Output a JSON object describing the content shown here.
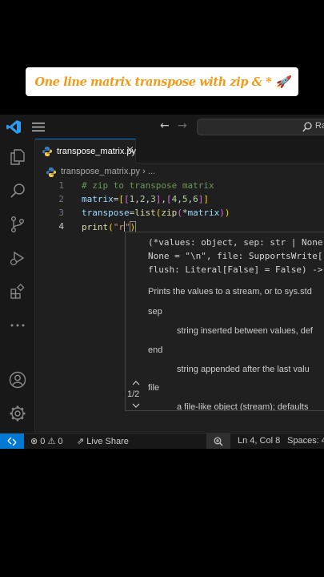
{
  "banner": {
    "text": "One line matrix transpose with zip & * 🚀"
  },
  "titlebar": {
    "search_text": "Ra"
  },
  "tab": {
    "label": "transpose_matrix.py",
    "close": "×"
  },
  "breadcrumb": {
    "text": "transpose_matrix.py › ..."
  },
  "editor": {
    "line_numbers": [
      "1",
      "2",
      "3",
      "4"
    ],
    "lines": [
      "# zip to transpose matrix",
      "matrix=[[1,2,3],[4,5,6]]",
      "transpose=list(zip(*matrix))",
      "print(\"r\")"
    ]
  },
  "hover": {
    "signature_lines": [
      "(*values: object, sep: str | None",
      "None = \"\\n\", file: SupportsWrite[",
      "flush: Literal[False] = False) ->"
    ],
    "description": "Prints the values to a stream, or to sys.std",
    "params": [
      {
        "name": "sep",
        "desc": "string inserted between values, def"
      },
      {
        "name": "end",
        "desc": "string appended after the last valu"
      },
      {
        "name": "file",
        "desc": "a file-like object (stream); defaults"
      }
    ],
    "overload": "1/2"
  },
  "statusbar": {
    "problems_errors": "0",
    "problems_warnings": "0",
    "live_share": "Live Share",
    "position": "Ln 4, Col 8",
    "spaces": "Spaces: 4"
  },
  "colors": {
    "accent": "#0078d4",
    "banner_text": "#f39a16",
    "editor_bg": "#1f1f1f"
  }
}
